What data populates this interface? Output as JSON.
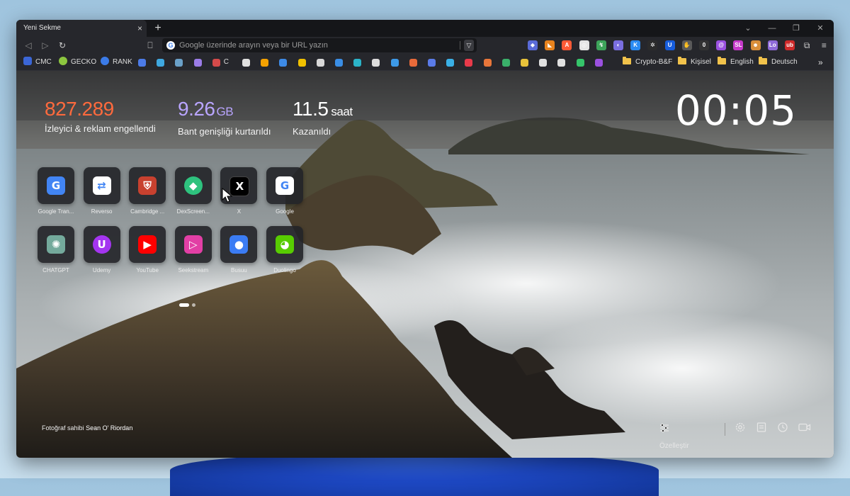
{
  "tab": {
    "title": "Yeni Sekme",
    "close": "×",
    "new_tab": "+"
  },
  "window_controls": {
    "chevron": "⌄",
    "minimize": "—",
    "maximize": "❐",
    "close": "✕"
  },
  "toolbar": {
    "back": "◁",
    "forward": "▷",
    "reload": "↻",
    "bookmark": "⎕",
    "omnibox_placeholder": "Google üzerinde arayın veya bir URL yazın",
    "omnibox_g": "G",
    "brave": "▽"
  },
  "extensions": [
    {
      "name": "ext-1",
      "color": "#5a6bd8",
      "glyph": "◆"
    },
    {
      "name": "metamask",
      "color": "#e8831d",
      "glyph": "◣"
    },
    {
      "name": "ext-3",
      "color": "#ff5a36",
      "glyph": "A"
    },
    {
      "name": "ext-4",
      "color": "#e5e5e5",
      "glyph": "◎"
    },
    {
      "name": "ext-5",
      "color": "#3da45a",
      "glyph": "↯"
    },
    {
      "name": "ext-6",
      "color": "#7a6ee0",
      "glyph": "◐"
    },
    {
      "name": "ext-7",
      "color": "#2a8bf2",
      "glyph": "K"
    },
    {
      "name": "ext-8",
      "color": "#2b2b2b",
      "glyph": "✲"
    },
    {
      "name": "bitwarden",
      "color": "#175ddc",
      "glyph": "U"
    },
    {
      "name": "ext-10",
      "color": "#5a5a5a",
      "glyph": "✋"
    },
    {
      "name": "ext-11",
      "color": "#333333",
      "glyph": "0"
    },
    {
      "name": "ext-12",
      "color": "#9b51e0",
      "glyph": "@"
    },
    {
      "name": "ext-13",
      "color": "#c63acb",
      "glyph": "SL"
    },
    {
      "name": "ext-14",
      "color": "#d98e3a",
      "glyph": "☻"
    },
    {
      "name": "ext-15",
      "color": "#8e6ad8",
      "glyph": "Lo"
    },
    {
      "name": "ext-16",
      "color": "#cf2a2a",
      "glyph": "ub"
    },
    {
      "name": "puzzle",
      "color": "#26272c",
      "glyph": "⧉"
    },
    {
      "name": "menu",
      "color": "#26272c",
      "glyph": "≡"
    }
  ],
  "bookmarks": {
    "labeled": [
      {
        "label": "CMC",
        "color": "#3b66d6"
      },
      {
        "label": "GECKO",
        "color": "#8cc63f"
      },
      {
        "label": "RANK",
        "color": "#3b7be8"
      }
    ],
    "icons": [
      {
        "name": "bm-icon-1",
        "color": "#4c7be8"
      },
      {
        "name": "bm-icon-2",
        "color": "#3fa8e0"
      },
      {
        "name": "bm-icon-3",
        "color": "#6aa0c8"
      },
      {
        "name": "bm-icon-4",
        "color": "#9b7ce8"
      },
      {
        "name": "bm-icon-5",
        "color": "#d44a4a"
      },
      {
        "name": "bm-icon-6",
        "color": "#e0e0e0"
      },
      {
        "name": "bm-icon-7",
        "color": "#f4a100"
      },
      {
        "name": "bm-icon-8",
        "color": "#3d8ae6"
      },
      {
        "name": "bm-icon-9",
        "color": "#f0c000"
      },
      {
        "name": "bm-icon-10",
        "color": "#d8d8d8"
      },
      {
        "name": "bm-icon-11",
        "color": "#3a8ee6"
      },
      {
        "name": "bm-icon-12",
        "color": "#2bb3c8"
      },
      {
        "name": "bm-icon-13",
        "color": "#dcdcdc"
      },
      {
        "name": "bm-icon-14",
        "color": "#3d9ae8"
      },
      {
        "name": "bm-icon-15",
        "color": "#e86a3a"
      },
      {
        "name": "bm-icon-16",
        "color": "#5a7be8"
      },
      {
        "name": "bm-icon-17",
        "color": "#3ab0e6"
      },
      {
        "name": "bm-icon-18",
        "color": "#e83a4a"
      },
      {
        "name": "bm-icon-19",
        "color": "#e8763a"
      },
      {
        "name": "bm-icon-20",
        "color": "#3ab06a"
      },
      {
        "name": "bm-icon-21",
        "color": "#e8c23a"
      },
      {
        "name": "bm-icon-22",
        "color": "#e0e0e0"
      },
      {
        "name": "bm-icon-23",
        "color": "#e0e0e0"
      },
      {
        "name": "bm-icon-24",
        "color": "#35c46a"
      },
      {
        "name": "bm-icon-25",
        "color": "#9b51e0"
      }
    ],
    "mid_label": "C",
    "folders": [
      "Crypto-B&F",
      "Kişisel",
      "English",
      "Deutsch"
    ],
    "overflow": "»"
  },
  "stats": {
    "blocked": {
      "value": "827.289",
      "label": "İzleyici & reklam engellendi",
      "color": "#ff6a3d"
    },
    "bandwidth": {
      "value": "9.26",
      "unit": "GB",
      "label": "Bant genişliği kurtarıldı",
      "color": "#b9a5ff"
    },
    "time": {
      "value": "11.5",
      "unit": "saat",
      "label": "Kazanıldı",
      "color": "#ffffff"
    }
  },
  "clock": "00:05",
  "tiles": [
    {
      "name": "tile-google-translate",
      "label": "Google Tran...",
      "color": "#4285f4",
      "glyph": "G"
    },
    {
      "name": "tile-reverso",
      "label": "Reverso",
      "color": "#ffffff",
      "glyph": "⇄"
    },
    {
      "name": "tile-cambridge",
      "label": "Cambridge ...",
      "color": "#c8412f",
      "glyph": "⛨"
    },
    {
      "name": "tile-dexscreener",
      "label": "DexScreen...",
      "color": "#2ec27e",
      "glyph": "◆"
    },
    {
      "name": "tile-x",
      "label": "X",
      "color": "#000000",
      "glyph": "X"
    },
    {
      "name": "tile-google",
      "label": "Google",
      "color": "#ffffff",
      "glyph": "G"
    },
    {
      "name": "tile-chatgpt",
      "label": "CHATGPT",
      "color": "#74aa9c",
      "glyph": "✺"
    },
    {
      "name": "tile-udemy",
      "label": "Udemy",
      "color": "#a435f0",
      "glyph": "U"
    },
    {
      "name": "tile-youtube",
      "label": "YouTube",
      "color": "#ff0000",
      "glyph": "▶"
    },
    {
      "name": "tile-streaming",
      "label": "Seekstream",
      "color": "#e23fa5",
      "glyph": "▷"
    },
    {
      "name": "tile-busuu",
      "label": "Busuu",
      "color": "#3b7cf4",
      "glyph": "●"
    },
    {
      "name": "tile-duolingo",
      "label": "Duolingo",
      "color": "#58cc02",
      "glyph": "◕"
    }
  ],
  "credit": {
    "prefix": "Fotoğraf sahibi",
    "author": "Sean O' Riordan"
  },
  "bottom": {
    "customize": "Özelleştir"
  }
}
